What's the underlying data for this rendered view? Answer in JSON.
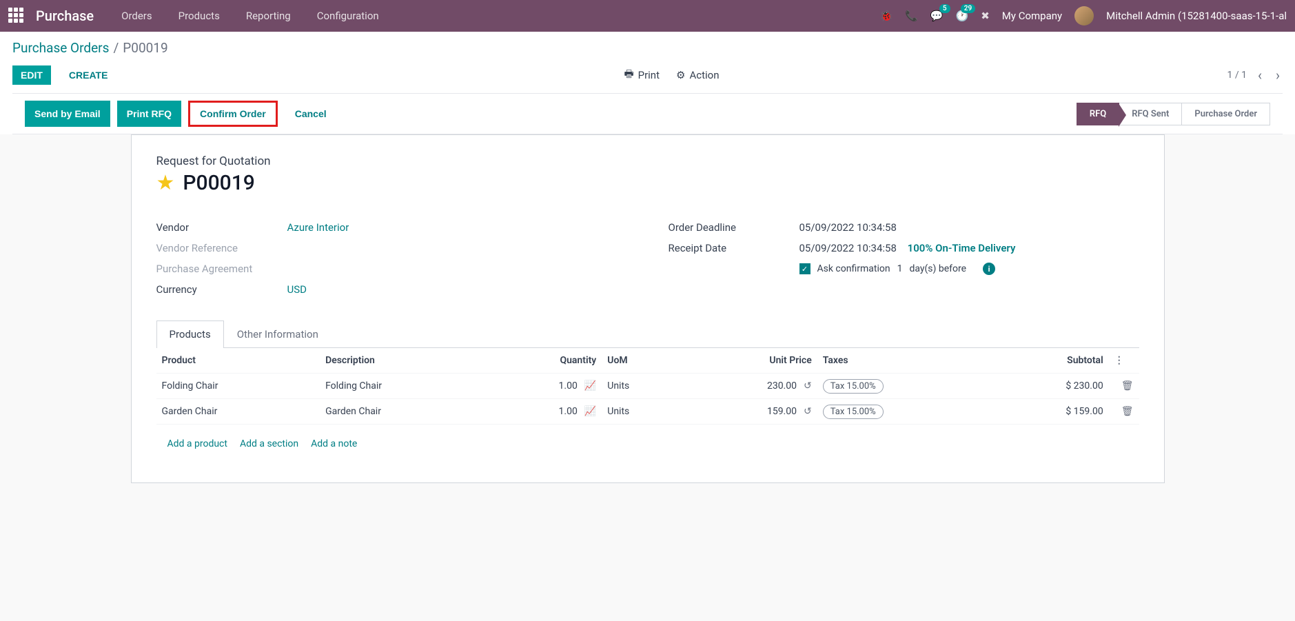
{
  "topbar": {
    "brand": "Purchase",
    "menu": [
      "Orders",
      "Products",
      "Reporting",
      "Configuration"
    ],
    "chat_badge": "5",
    "activity_badge": "29",
    "company": "My Company",
    "user": "Mitchell Admin (15281400-saas-15-1-al"
  },
  "breadcrumb": {
    "parent": "Purchase Orders",
    "current": "P00019"
  },
  "controls": {
    "edit": "Edit",
    "create": "Create",
    "print": "Print",
    "action": "Action",
    "pager": "1 / 1"
  },
  "statusbar": {
    "buttons": [
      "Send by Email",
      "Print RFQ",
      "Confirm Order",
      "Cancel"
    ],
    "steps": [
      "RFQ",
      "RFQ Sent",
      "Purchase Order"
    ]
  },
  "sheet": {
    "title_label": "Request for Quotation",
    "order_number": "P00019",
    "fields_left": {
      "vendor_label": "Vendor",
      "vendor_value": "Azure Interior",
      "vendor_ref_label": "Vendor Reference",
      "purchase_agreement_label": "Purchase Agreement",
      "currency_label": "Currency",
      "currency_value": "USD"
    },
    "fields_right": {
      "deadline_label": "Order Deadline",
      "deadline_value": "05/09/2022 10:34:58",
      "receipt_label": "Receipt Date",
      "receipt_value": "05/09/2022 10:34:58",
      "delivery_link": "100% On-Time Delivery",
      "ask_confirm_prefix": "Ask confirmation",
      "ask_confirm_days": "1",
      "ask_confirm_suffix": "day(s) before"
    },
    "tabs": [
      "Products",
      "Other Information"
    ],
    "table": {
      "headers": [
        "Product",
        "Description",
        "Quantity",
        "UoM",
        "Unit Price",
        "Taxes",
        "Subtotal"
      ],
      "rows": [
        {
          "product": "Folding Chair",
          "description": "Folding Chair",
          "quantity": "1.00",
          "uom": "Units",
          "unit_price": "230.00",
          "tax": "Tax 15.00%",
          "subtotal": "$ 230.00"
        },
        {
          "product": "Garden Chair",
          "description": "Garden Chair",
          "quantity": "1.00",
          "uom": "Units",
          "unit_price": "159.00",
          "tax": "Tax 15.00%",
          "subtotal": "$ 159.00"
        }
      ],
      "add_product": "Add a product",
      "add_section": "Add a section",
      "add_note": "Add a note"
    }
  }
}
